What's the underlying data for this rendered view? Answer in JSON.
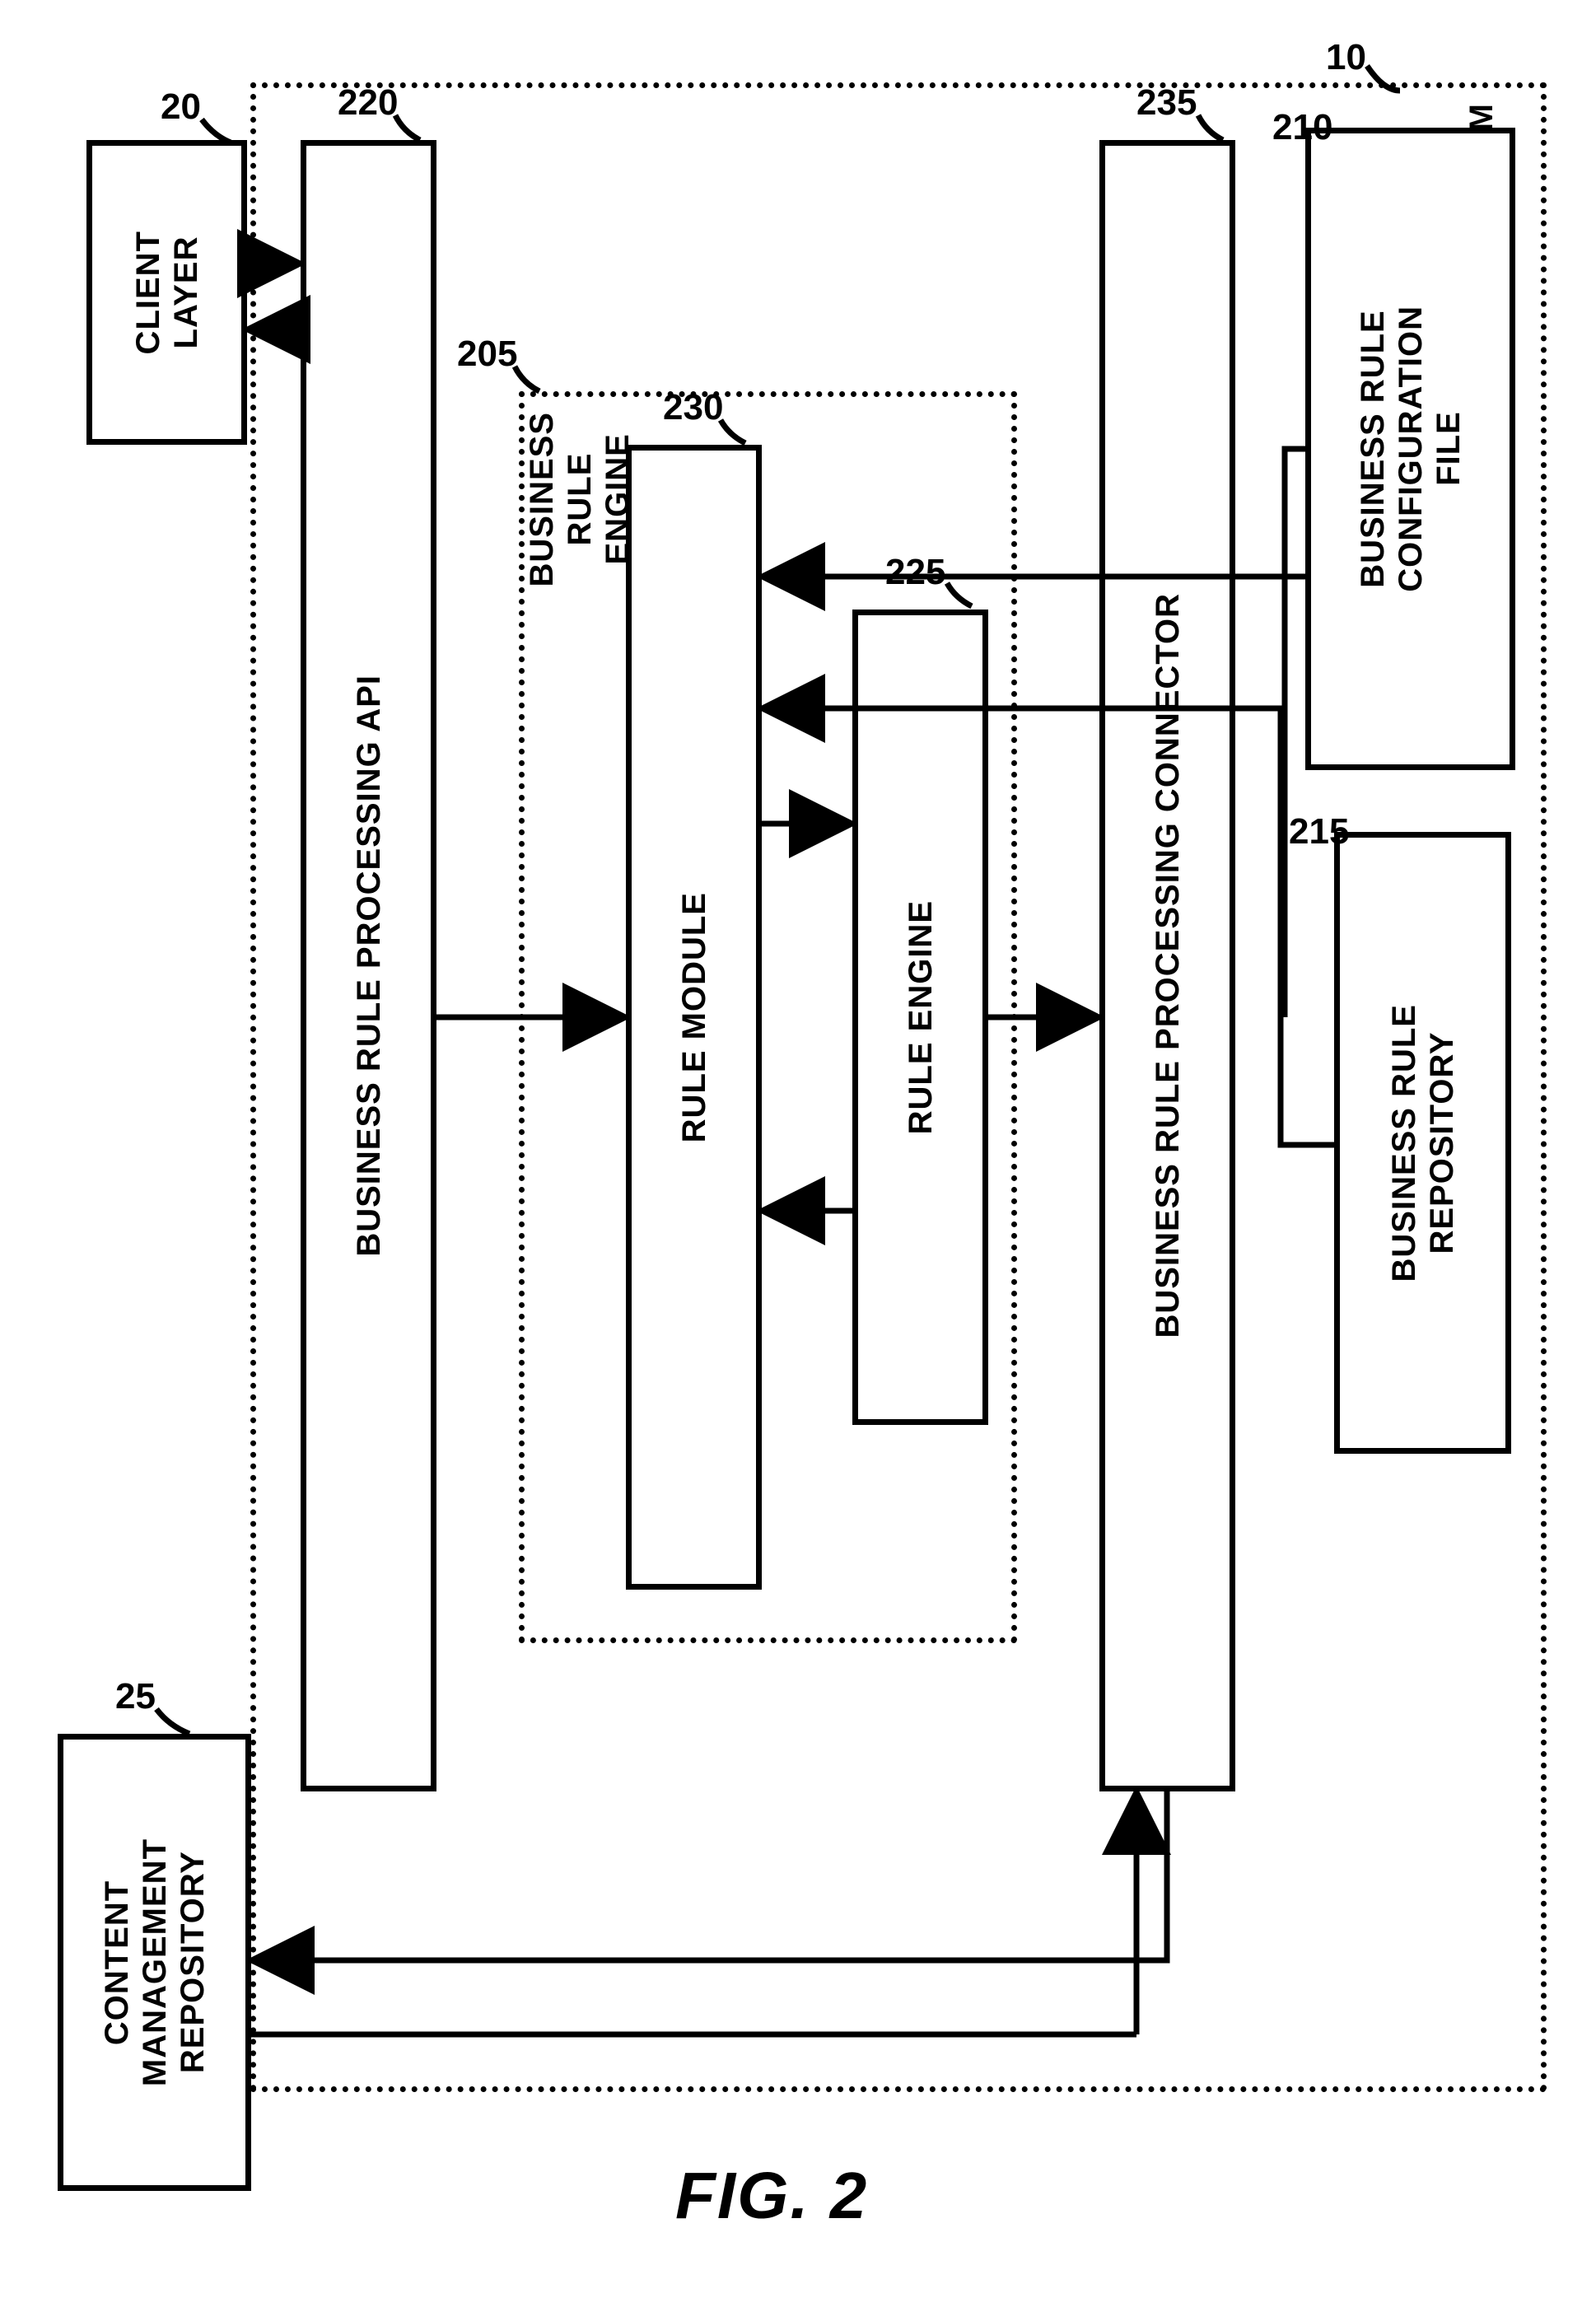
{
  "figure_label": "FIG. 2",
  "system": {
    "title": "BUSINESS RULE\nPROCESSING SYSTEM",
    "ref": "10"
  },
  "client_layer": {
    "label": "CLIENT\nLAYER",
    "ref": "20"
  },
  "content_repo": {
    "label": "CONTENT\nMANAGEMENT\nREPOSITORY",
    "ref": "25"
  },
  "api": {
    "label": "BUSINESS RULE PROCESSING API",
    "ref": "220"
  },
  "connector": {
    "label": "BUSINESS RULE PROCESSING CONNECTOR",
    "ref": "235"
  },
  "config_file": {
    "label": "BUSINESS RULE\nCONFIGURATION\nFILE",
    "ref": "210"
  },
  "rule_repo": {
    "label": "BUSINESS RULE\nREPOSITORY",
    "ref": "215"
  },
  "business_rule_engine": {
    "label": "BUSINESS\nRULE\nENGINE",
    "ref": "205"
  },
  "rule_module": {
    "label": "RULE MODULE",
    "ref": "230"
  },
  "rule_engine": {
    "label": "RULE ENGINE",
    "ref": "225"
  }
}
